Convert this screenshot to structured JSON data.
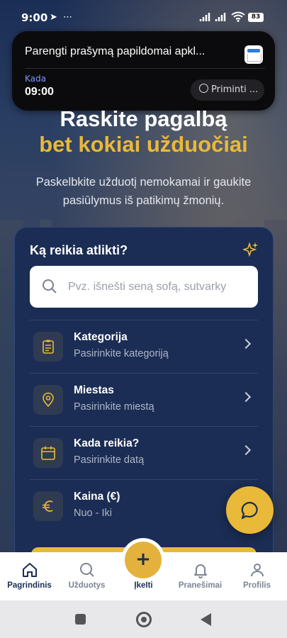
{
  "status_bar": {
    "time": "9:00",
    "battery": "83"
  },
  "notification": {
    "title": "Parengti prašymą papildomai apkl...",
    "when_label": "Kada",
    "when_value": "09:00",
    "remind_button": "Priminti ..."
  },
  "hero": {
    "title_line1": "Raskite pagalbą",
    "title_line2": "bet kokiai užduočiai",
    "subtitle": "Paskelbkite užduotį nemokamai ir gaukite pasiūlymus iš patikimų žmonių."
  },
  "search_card": {
    "question": "Ką reikia atlikti?",
    "search_placeholder": "Pvz. išnešti seną sofą, sutvarky",
    "rows": [
      {
        "label": "Kategorija",
        "hint": "Pasirinkite kategoriją",
        "icon": "clipboard-icon"
      },
      {
        "label": "Miestas",
        "hint": "Pasirinkite miestą",
        "icon": "location-pin-icon"
      },
      {
        "label": "Kada reikia?",
        "hint": "Pasirinkite datą",
        "icon": "calendar-icon"
      },
      {
        "label": "Kaina (€)",
        "hint": "Nuo - Iki",
        "icon": "euro-icon"
      }
    ]
  },
  "bottom_nav": {
    "items": [
      {
        "label": "Pagrindinis",
        "icon": "home-icon",
        "active": true
      },
      {
        "label": "Užduotys",
        "icon": "search-icon"
      },
      {
        "label": "Įkelti",
        "icon": "plus-icon"
      },
      {
        "label": "Pranešimai",
        "icon": "bell-icon"
      },
      {
        "label": "Profilis",
        "icon": "user-icon"
      }
    ]
  },
  "colors": {
    "accent": "#e9b93a",
    "navy": "#1b2d54"
  }
}
